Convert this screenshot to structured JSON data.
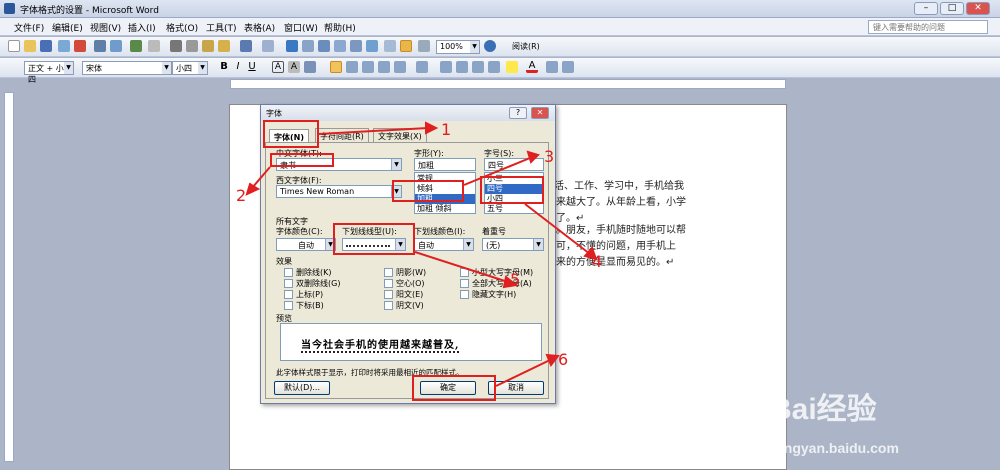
{
  "window": {
    "title": "字体格式的设置 - Microsoft Word"
  },
  "menubar": {
    "items": [
      "文件(F)",
      "编辑(E)",
      "视图(V)",
      "插入(I)",
      "格式(O)",
      "工具(T)",
      "表格(A)",
      "窗口(W)",
      "帮助(H)"
    ],
    "help_placeholder": "键入需要帮助的问题"
  },
  "toolbar": {
    "zoom": "100%",
    "reading": "阅读(R)",
    "style": "正文 + 小四",
    "font": "宋体",
    "size": "小四"
  },
  "document": {
    "lines": [
      "活、工作、学习中，手机给我",
      "来越大了。从年龄上看，小学",
      "了。↵",
      "。朋友，手机随时随地可以帮",
      "可，不懂的问题，用手机上",
      "来的方便是显而易见的。↵"
    ]
  },
  "dialog": {
    "title": "字体",
    "help_btn": "?",
    "close_btn": "✕",
    "tabs": [
      "字体(N)",
      "字符间距(R)",
      "文字效果(X)"
    ],
    "chinese_font_label": "中文字体(T):",
    "chinese_font_value": "隶书",
    "western_font_label": "西文字体(F):",
    "western_font_value": "Times New Roman",
    "style_label": "字形(Y):",
    "style_value": "加粗",
    "style_list": [
      "常规",
      "倾斜",
      "加粗",
      "加粗 倾斜"
    ],
    "size_label": "字号(S):",
    "size_value": "四号",
    "size_list": [
      "小三",
      "四号",
      "小四",
      "五号"
    ],
    "all_text_label": "所有文字",
    "color_label": "字体颜色(C):",
    "color_value": "自动",
    "underline_label": "下划线线型(U):",
    "underline_color_label": "下划线颜色(I):",
    "underline_color_value": "自动",
    "emphasis_label": "着重号",
    "emphasis_value": "(无)",
    "effects_label": "效果",
    "effects": [
      {
        "label": "删除线(K)",
        "checked": false
      },
      {
        "label": "双删除线(G)",
        "checked": false
      },
      {
        "label": "上标(P)",
        "checked": false
      },
      {
        "label": "下标(B)",
        "checked": false
      },
      {
        "label": "阴影(W)",
        "checked": false
      },
      {
        "label": "空心(O)",
        "checked": false
      },
      {
        "label": "阳文(E)",
        "checked": false
      },
      {
        "label": "阴文(V)",
        "checked": false
      },
      {
        "label": "小型大写字母(M)",
        "checked": false
      },
      {
        "label": "全部大写字母(A)",
        "checked": false
      },
      {
        "label": "隐藏文字(H)",
        "checked": false
      }
    ],
    "preview_label": "预览",
    "preview_text": "当今社会手机的使用越来越普及,",
    "note": "此字体样式限于显示，打印时将采用最相近的匹配样式。",
    "default_btn": "默认(D)...",
    "ok_btn": "确定",
    "cancel_btn": "取消"
  },
  "annotations": [
    "1",
    "2",
    "3",
    "4",
    "5",
    "6"
  ],
  "watermark": {
    "brand": "Bai经验",
    "url": "jingyan.baidu.com"
  }
}
